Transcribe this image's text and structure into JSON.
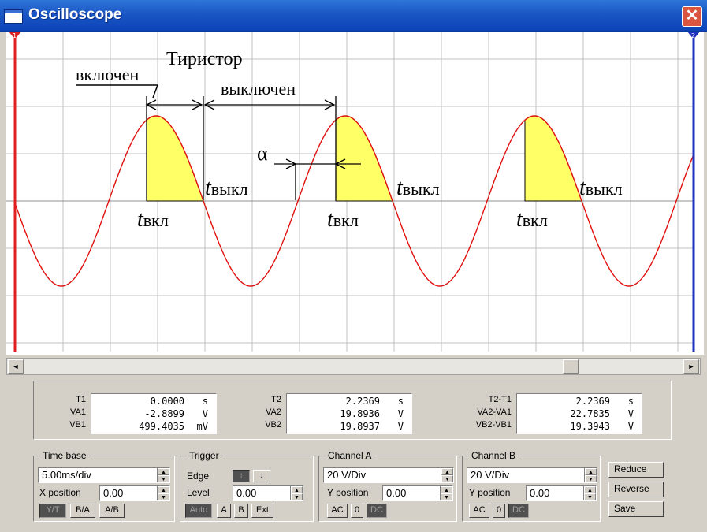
{
  "window": {
    "title": "Oscilloscope",
    "close": "✕"
  },
  "screen": {
    "colors": {
      "background": "#ffffff",
      "grid": "#c0c0c0",
      "trace": "#e01010",
      "fill": "#ffff66",
      "cursor1": "#e02020",
      "cursor2": "#2030c0"
    },
    "cursor_markers": {
      "cursor1": "1",
      "cursor2": "2"
    },
    "annotations": {
      "thyristor": "Тиристор",
      "on": "включен",
      "off": "выключен",
      "alpha": "α",
      "t": "t",
      "t_on_sub": "вкл",
      "t_off_sub": "выкл"
    }
  },
  "scrollbar": {
    "left_arrow": "◄",
    "right_arrow": "►"
  },
  "readouts": {
    "t1": {
      "labels": [
        "T1",
        "VA1",
        "VB1"
      ],
      "values": [
        "0.0000",
        "-2.8899",
        "499.4035"
      ],
      "units": [
        "s",
        "V",
        "mV"
      ]
    },
    "t2": {
      "labels": [
        "T2",
        "VA2",
        "VB2"
      ],
      "values": [
        "2.2369",
        "19.8936",
        "19.8937"
      ],
      "units": [
        "s",
        "V",
        "V"
      ]
    },
    "diff": {
      "labels": [
        "T2-T1",
        "VA2-VA1",
        "VB2-VB1"
      ],
      "values": [
        "2.2369",
        "22.7835",
        "19.3943"
      ],
      "units": [
        "s",
        "V",
        "V"
      ]
    }
  },
  "timebase": {
    "title": "Time base",
    "value": "5.00ms/div",
    "xpos_label": "X position",
    "xpos_value": "0.00",
    "modes": [
      "Y/T",
      "B/A",
      "A/B"
    ]
  },
  "trigger": {
    "title": "Trigger",
    "edge_label": "Edge",
    "edge_rise": "↑",
    "edge_fall": "↓",
    "level_label": "Level",
    "level_value": "0.00",
    "sources": [
      "Auto",
      "A",
      "B",
      "Ext"
    ]
  },
  "channel_a": {
    "title": "Channel A",
    "value": "20 V/Div",
    "ypos_label": "Y position",
    "ypos_value": "0.00",
    "coupling": [
      "AC",
      "0",
      "DC"
    ]
  },
  "channel_b": {
    "title": "Channel B",
    "value": "20 V/Div",
    "ypos_label": "Y position",
    "ypos_value": "0.00",
    "coupling": [
      "AC",
      "0",
      "DC"
    ]
  },
  "actions": {
    "reduce": "Reduce",
    "reverse": "Reverse",
    "save": "Save"
  }
}
